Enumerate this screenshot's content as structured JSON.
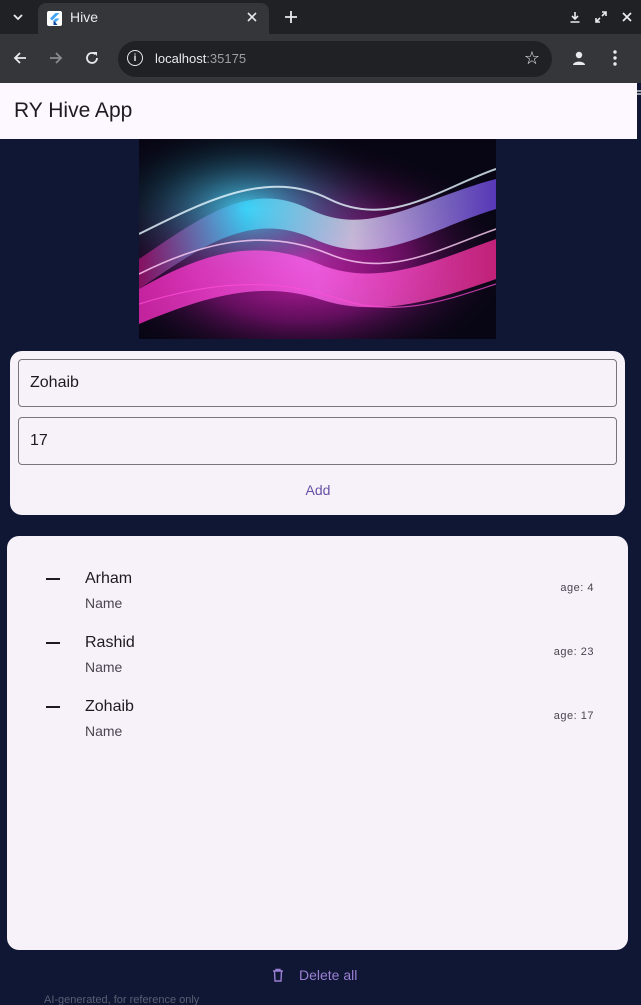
{
  "browser": {
    "tab_title": "Hive",
    "url_host": "localhost",
    "url_port": ":35175"
  },
  "app": {
    "title": "RY Hive App"
  },
  "form": {
    "name_value": "Zohaib",
    "age_value": "17",
    "add_label": "Add"
  },
  "list": {
    "items": [
      {
        "name": "Arham",
        "subtitle": "Name",
        "age": "age: 4"
      },
      {
        "name": "Rashid",
        "subtitle": "Name",
        "age": "age: 23"
      },
      {
        "name": "Zohaib",
        "subtitle": "Name",
        "age": "age: 17"
      }
    ]
  },
  "actions": {
    "delete_all_label": "Delete all"
  },
  "footer": {
    "note": "AI-generated, for reference only"
  },
  "theme": {
    "page_bg": "#0f1735",
    "card_bg": "#f7f2fa",
    "primary": "#6750a4"
  }
}
